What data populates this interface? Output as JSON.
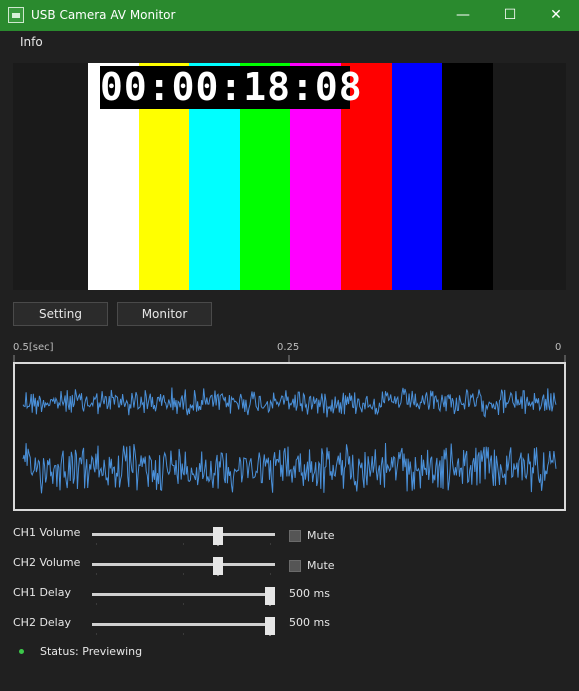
{
  "window": {
    "title": "USB Camera AV Monitor",
    "accent_color": "#2a8a2e",
    "controls": {
      "minimize": "—",
      "maximize": "☐",
      "close": "✕"
    }
  },
  "menu": {
    "items": [
      {
        "label": "Info"
      }
    ]
  },
  "preview": {
    "timecode": "00:00:18:08",
    "color_bars": [
      "#ffffff",
      "#ffff00",
      "#00ffff",
      "#00ff00",
      "#ff00ff",
      "#ff0000",
      "#0000ff",
      "#000000"
    ]
  },
  "tabs": {
    "setting_label": "Setting",
    "monitor_label": "Monitor"
  },
  "waveform": {
    "axis_left": "0.5[sec]",
    "axis_mid": "0.25",
    "axis_right": "0",
    "line_color": "#4a90d9"
  },
  "controls": {
    "ch1_volume": {
      "label": "CH1 Volume",
      "level": 0.7,
      "mute_label": "Mute"
    },
    "ch2_volume": {
      "label": "CH2 Volume",
      "level": 0.7,
      "mute_label": "Mute"
    },
    "ch1_delay": {
      "label": "CH1 Delay",
      "level": 1.0,
      "value": "500 ms"
    },
    "ch2_delay": {
      "label": "CH2 Delay",
      "level": 1.0,
      "value": "500 ms"
    }
  },
  "status": {
    "text": "Status: Previewing",
    "color": "#3cc84a"
  }
}
